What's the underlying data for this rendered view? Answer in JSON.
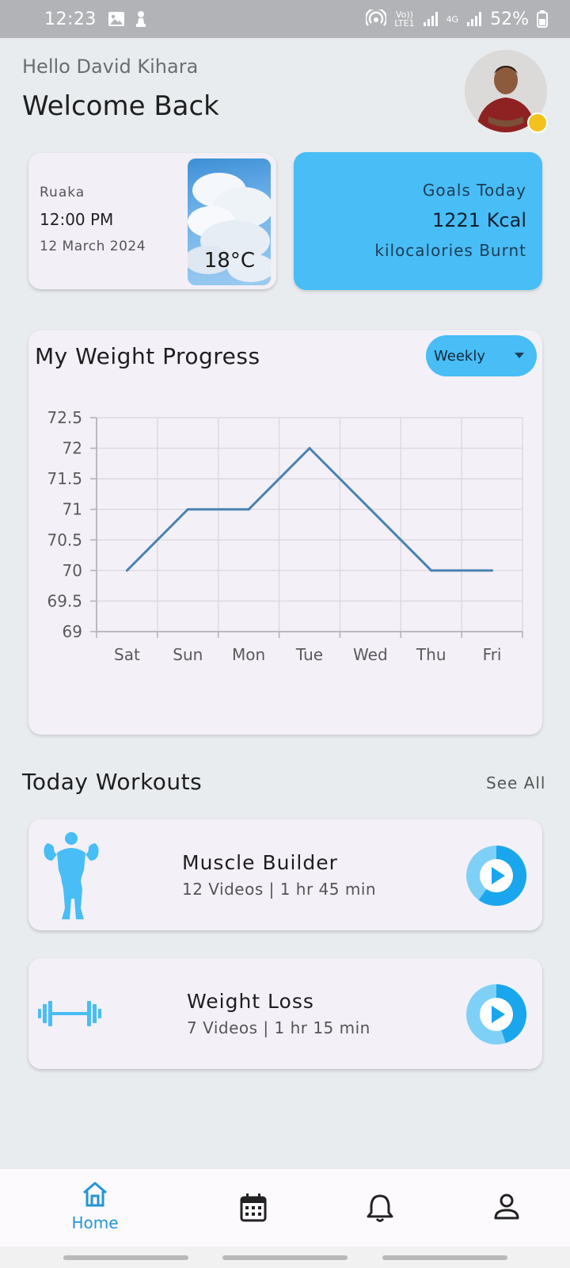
{
  "status_bar": {
    "time": "12:23",
    "network_top": "Vo))",
    "network_bottom": "LTE1",
    "cell_label": "4G",
    "battery": "52%"
  },
  "header": {
    "greeting": "Hello David Kihara",
    "title": "Welcome Back"
  },
  "weather": {
    "location": "Ruaka",
    "time": "12:00 PM",
    "date": "12 March 2024",
    "temperature": "18°C"
  },
  "goals": {
    "title": "Goals Today",
    "value": "1221 Kcal",
    "caption": "kilocalories Burnt"
  },
  "weight_progress": {
    "title": "My Weight Progress",
    "period": "Weekly"
  },
  "chart_data": {
    "type": "line",
    "categories": [
      "Sat",
      "Sun",
      "Mon",
      "Tue",
      "Wed",
      "Thu",
      "Fri"
    ],
    "values": [
      70,
      71,
      71,
      72,
      71,
      70,
      70
    ],
    "y_ticks": [
      "72.5",
      "72",
      "71.5",
      "71",
      "70.5",
      "70",
      "69.5",
      "69"
    ],
    "ylim": [
      69,
      72.5
    ],
    "grid": true,
    "line_color": "#4a82b0"
  },
  "workouts": {
    "title": "Today Workouts",
    "see_all": "See All",
    "items": [
      {
        "name": "Muscle Builder",
        "details": "12 Videos | 1 hr 45 min",
        "progress": 0.6,
        "icon": "bodybuilder-icon"
      },
      {
        "name": "Weight Loss",
        "details": "7 Videos | 1 hr 15 min",
        "progress": 0.45,
        "icon": "dumbbell-icon"
      }
    ]
  },
  "nav": {
    "home_label": "Home",
    "items": [
      "home-icon",
      "calendar-icon",
      "bell-icon",
      "profile-icon"
    ]
  },
  "colors": {
    "accent": "#48bdf6",
    "background": "#e9ecef",
    "card": "#f3f0f7",
    "nav_active": "#2494d6"
  }
}
